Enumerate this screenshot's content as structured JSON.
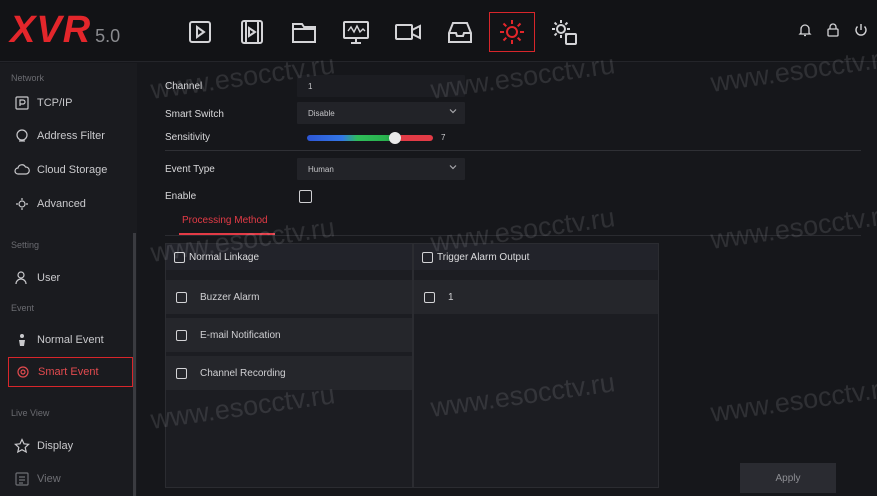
{
  "brand": {
    "logo": "XVR",
    "version": "5.0"
  },
  "topnav": [
    {
      "name": "playback-icon"
    },
    {
      "name": "file-icon"
    },
    {
      "name": "folder-icon"
    },
    {
      "name": "monitor-icon"
    },
    {
      "name": "camera-icon"
    },
    {
      "name": "storage-icon"
    },
    {
      "name": "settings-gear-icon",
      "active": true
    },
    {
      "name": "system-gear-icon"
    }
  ],
  "sidebar": {
    "sections": [
      "Network",
      "Setting",
      "Event",
      "Live View"
    ],
    "items": [
      {
        "label": "TCP/IP",
        "icon": "ip-icon"
      },
      {
        "label": "Address Filter",
        "icon": "filter-icon"
      },
      {
        "label": "Cloud Storage",
        "icon": "cloud-icon"
      },
      {
        "label": "Advanced",
        "icon": "advanced-icon"
      },
      {
        "label": "User",
        "icon": "user-icon"
      },
      {
        "label": "Normal Event",
        "icon": "event-icon"
      },
      {
        "label": "Smart Event",
        "icon": "smart-event-icon",
        "active": true
      },
      {
        "label": "Display",
        "icon": "star-icon"
      },
      {
        "label": "View",
        "icon": "view-icon"
      }
    ]
  },
  "form": {
    "channel_label": "Channel",
    "channel_value": "1",
    "smart_switch_label": "Smart Switch",
    "smart_switch_value": "Disable",
    "sensitivity_label": "Sensitivity",
    "sensitivity_value": "7",
    "sensitivity_level": 0.7,
    "event_type_label": "Event Type",
    "event_type_value": "Human",
    "enable_label": "Enable"
  },
  "tabs": {
    "processing": "Processing Method"
  },
  "linkage": {
    "normal_header": "Normal Linkage",
    "options": [
      "Buzzer Alarm",
      "E-mail Notification",
      "Channel Recording"
    ],
    "trigger_header": "Trigger Alarm Output",
    "trigger_options": [
      "1"
    ]
  },
  "apply_label": "Apply",
  "watermark": "www.esocctv.ru",
  "colors": {
    "accent": "#e3262b",
    "background": "#16171b"
  }
}
